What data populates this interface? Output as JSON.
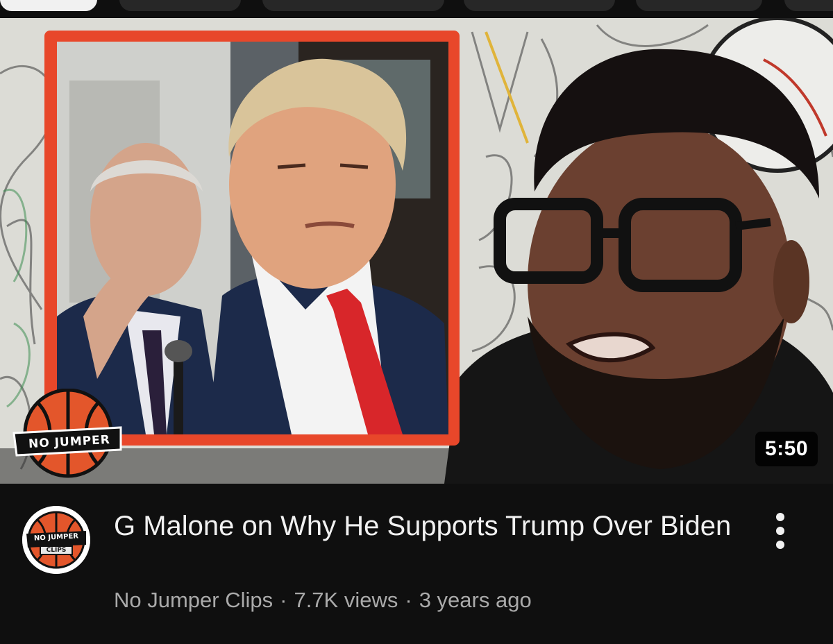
{
  "video": {
    "duration": "5:50",
    "thumbnail_logo_text": "NO JUMPER",
    "title": "G Malone on Why He Supports Trump Over Biden",
    "channel": "No Jumper Clips",
    "views": "7.7K views",
    "age": "3 years ago",
    "separator": "·",
    "avatar_text_1": "NO JUMPER",
    "avatar_text_2": "CLIPS"
  },
  "icons": {
    "more": "vertical-ellipsis-icon",
    "logo": "basketball-icon"
  },
  "colors": {
    "background": "#0f0f0f",
    "title": "#f1f1f1",
    "meta": "#aaaaaa",
    "frame": "#e8472a",
    "logo_orange": "#e3562b"
  }
}
